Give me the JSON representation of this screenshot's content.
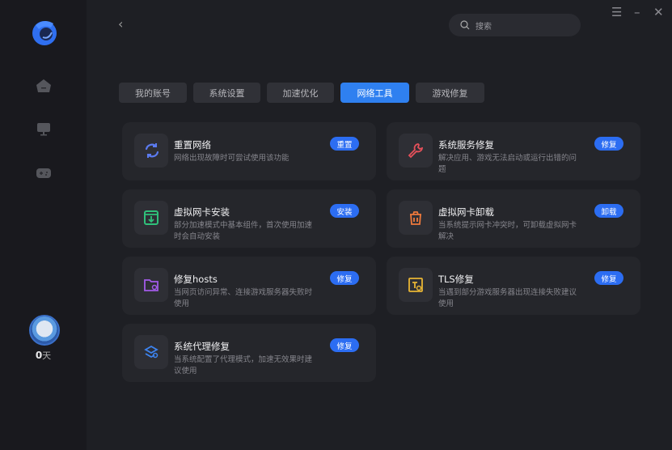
{
  "sidebar": {
    "nav": [
      "home-icon",
      "monitor-icon",
      "gamepad-icon"
    ],
    "days_value": "0",
    "days_unit": "天"
  },
  "header": {
    "search_placeholder": "搜索"
  },
  "tabs": [
    {
      "label": "我的账号",
      "w": 84
    },
    {
      "label": "系统设置",
      "w": 83
    },
    {
      "label": "加速优化",
      "w": 83
    },
    {
      "label": "网络工具",
      "w": 85,
      "active": true
    },
    {
      "label": "游戏修复",
      "w": 85
    }
  ],
  "cards": [
    {
      "title": "重置网络",
      "desc": "网络出现故障时可尝试使用该功能",
      "button": "重置",
      "icon": "refresh-icon",
      "color": "#5b7bf0"
    },
    {
      "title": "系统服务修复",
      "desc": "解决应用、游戏无法启动或运行出错的问题",
      "button": "修复",
      "icon": "wrench-icon",
      "color": "#e5505a"
    },
    {
      "title": "虚拟网卡安装",
      "desc": "部分加速模式中基本组件，首次使用加速时会自动安装",
      "button": "安装",
      "icon": "download-box-icon",
      "color": "#2fc07a"
    },
    {
      "title": "虚拟网卡卸载",
      "desc": "当系统提示网卡冲突时，可卸载虚拟网卡解决",
      "button": "卸载",
      "icon": "trash-icon",
      "color": "#ef7a3c"
    },
    {
      "title": "修复hosts",
      "desc": "当网页访问异常、连接游戏服务器失败时使用",
      "button": "修复",
      "icon": "folder-gear-icon",
      "color": "#a25be8"
    },
    {
      "title": "TLS修复",
      "desc": "当遇到部分游戏服务器出现连接失败建议使用",
      "button": "修复",
      "icon": "tls-icon",
      "color": "#e8b534"
    },
    {
      "title": "系统代理修复",
      "desc": "当系统配置了代理模式，加速无效果时建议使用",
      "button": "修复",
      "icon": "proxy-icon",
      "color": "#3d84f0"
    }
  ]
}
